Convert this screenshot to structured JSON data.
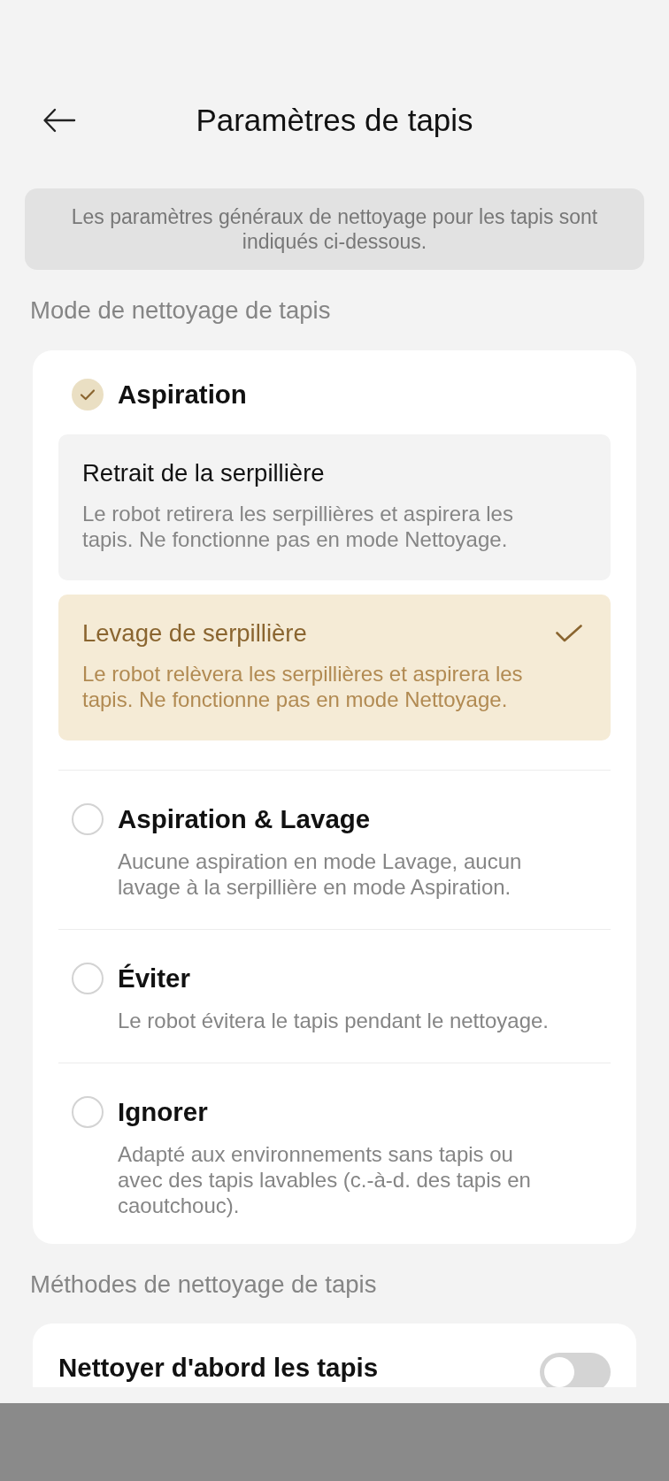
{
  "header": {
    "title": "Paramètres de tapis"
  },
  "notice": "Les paramètres généraux de nettoyage pour les tapis sont indiqués ci-dessous.",
  "mode_section": {
    "label": "Mode de nettoyage de tapis",
    "options": [
      {
        "title": "Aspiration",
        "selected": true,
        "sub_options": [
          {
            "title": "Retrait de la serpillière",
            "description": "Le robot retirera les serpillières et aspirera les tapis. Ne fonctionne pas en mode Nettoyage.",
            "selected": false
          },
          {
            "title": "Levage de serpillière",
            "description": "Le robot relèvera les serpillières et aspirera les tapis. Ne fonctionne pas en mode Nettoyage.",
            "selected": true
          }
        ]
      },
      {
        "title": "Aspiration & Lavage",
        "description": "Aucune aspiration en mode Lavage, aucun lavage à la serpillière en mode Aspiration.",
        "selected": false
      },
      {
        "title": "Éviter",
        "description": "Le robot évitera le tapis pendant le nettoyage.",
        "selected": false
      },
      {
        "title": "Ignorer",
        "description": "Adapté aux environnements sans tapis ou avec des tapis lavables (c.-à-d. des tapis en caoutchouc).",
        "selected": false
      }
    ]
  },
  "methods_section": {
    "label": "Méthodes de nettoyage de tapis",
    "items": [
      {
        "title": "Nettoyer d'abord les tapis",
        "on": false
      }
    ]
  }
}
